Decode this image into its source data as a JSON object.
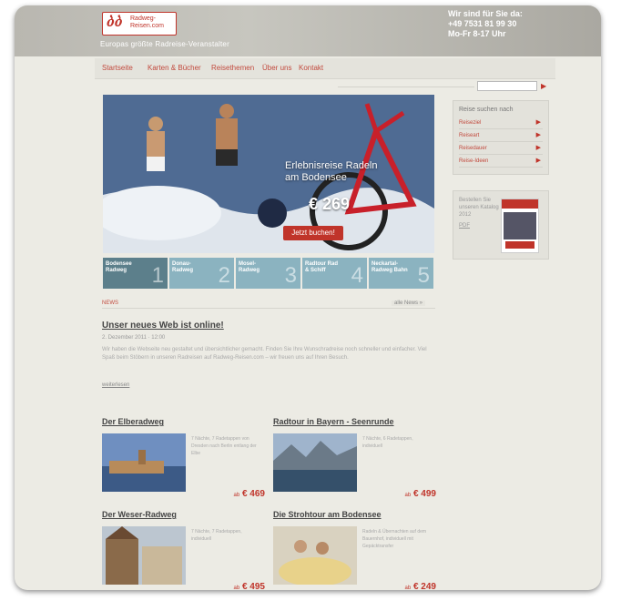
{
  "header": {
    "logo_line1": "Radweg-",
    "logo_line2": "Reisen.com",
    "tagline": "Europas größte Radreise-Veranstalter",
    "contact_line1": "Wir sind für Sie da:",
    "contact_line2": "+49 7531 81 99 30",
    "contact_line3": "Mo-Fr 8-17 Uhr"
  },
  "nav": {
    "items": [
      "Startseite",
      "Karten & Bücher",
      "Reisethemen",
      "Über uns",
      "Kontakt"
    ]
  },
  "hero": {
    "headline_line1": "Erlebnisreise Radeln",
    "headline_line2": "am Bodensee",
    "price": "€ 269",
    "cta": "Jetzt buchen!"
  },
  "tabs": [
    {
      "label": "Bodensee Radweg",
      "num": "1"
    },
    {
      "label": "Donau-Radweg",
      "num": "2"
    },
    {
      "label": "Mosel-Radweg",
      "num": "3"
    },
    {
      "label": "Radtour Rad & Schiff",
      "num": "4"
    },
    {
      "label": "Neckartal-Radweg Bahn",
      "num": "5"
    }
  ],
  "news": {
    "section": "NEWS",
    "more": "alle News »",
    "title": "Unser neues Web ist online!",
    "date": "2. Dezember 2011 · 12:00",
    "body": "Wir haben die Webseite neu gestaltet und übersichtlicher gemacht. Finden Sie Ihre Wunschradreise noch schneller und einfacher. Viel Spaß beim Stöbern in unseren Radreisen auf Radweg-Reisen.com – wir freuen uns auf Ihren Besuch.",
    "more_link": "weiterlesen"
  },
  "tours": [
    {
      "title": "Der Elberadweg",
      "desc": "7 Nächte, 7 Radetappen von Dresden nach Berlin entlang der Elbe",
      "price_prefix": "ab",
      "price": "€ 469"
    },
    {
      "title": "Radtour in Bayern - Seenrunde",
      "desc": "7 Nächte, 6 Radetappen, individuell",
      "price_prefix": "ab",
      "price": "€ 499"
    },
    {
      "title": "Der Weser-Radweg",
      "desc": "7 Nächte, 7 Radetappen, individuell",
      "price_prefix": "ab",
      "price": "€ 495"
    },
    {
      "title": "Die Strohtour am Bodensee",
      "desc": "Radeln & Übernachten auf dem Bauernhof, individuell mit Gepäcktransfer",
      "price_prefix": "ab",
      "price": "€ 249"
    }
  ],
  "sidebar": {
    "heading": "Reise suchen nach",
    "items": [
      "Reiseziel",
      "Reiseart",
      "Reisedauer",
      "Reise-Ideen"
    ],
    "catalog_text": "Bestellen Sie unseren Katalog 2012",
    "catalog_link": "PDF"
  },
  "colors": {
    "accent": "#c0342a",
    "tab": "#8bb3c0",
    "tab_active": "#5c7f8b"
  }
}
